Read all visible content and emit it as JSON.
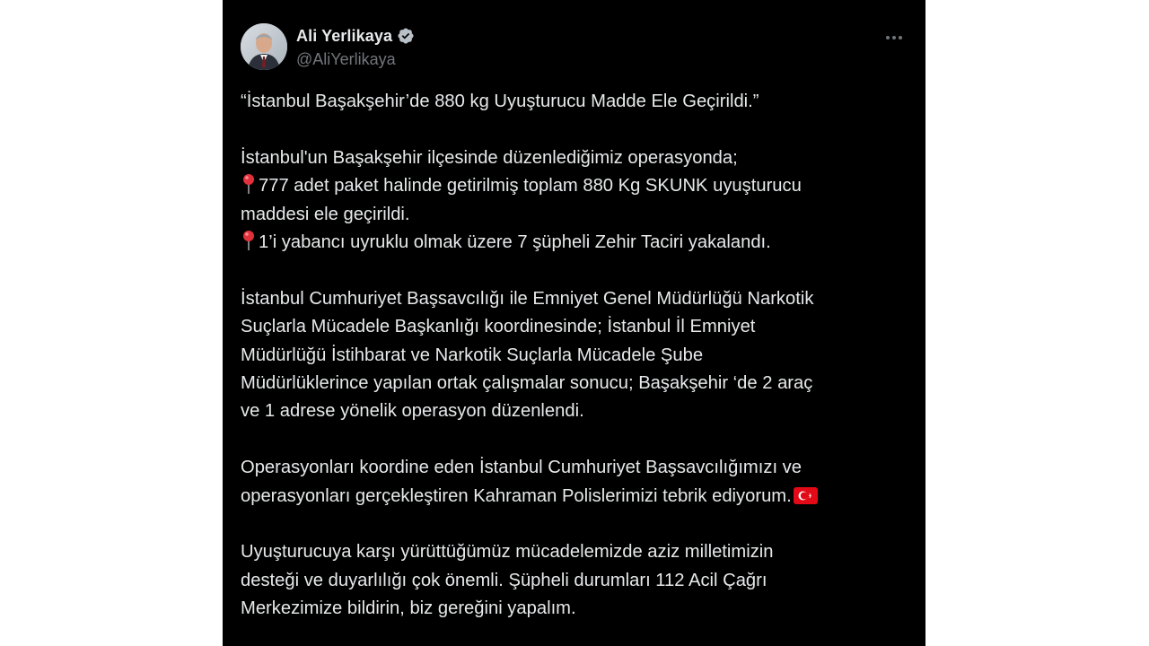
{
  "tweet": {
    "author": {
      "name": "Ali Yerlikaya",
      "handle": "@AliYerlikaya",
      "verified": true,
      "avatar_icon": "profile-photo"
    },
    "more_icon": "more-horizontal-icon",
    "paragraphs": [
      {
        "lines": [
          {
            "text": "“İstanbul Başakşehir’de 880 kg Uyuşturucu Madde Ele Geçirildi.”"
          }
        ]
      },
      {
        "lines": [
          {
            "text": "İstanbul'un Başakşehir ilçesinde düzenlediğimiz operasyonda;"
          },
          {
            "icon": "pin-icon",
            "text": "777 adet paket halinde getirilmiş toplam 880 Kg SKUNK uyuşturucu"
          },
          {
            "text": "maddesi ele geçirildi."
          },
          {
            "icon": "pin-icon",
            "text": "1’i yabancı uyruklu olmak üzere 7 şüpheli Zehir Taciri yakalandı."
          }
        ]
      },
      {
        "lines": [
          {
            "text": "İstanbul Cumhuriyet Başsavcılığı ile Emniyet Genel Müdürlüğü Narkotik"
          },
          {
            "text": "Suçlarla Mücadele Başkanlığı koordinesinde; İstanbul İl Emniyet"
          },
          {
            "text": "Müdürlüğü İstihbarat ve Narkotik Suçlarla Mücadele Şube"
          },
          {
            "text": "Müdürlüklerince yapılan ortak çalışmalar sonucu; Başakşehir ‘de 2 araç"
          },
          {
            "text": "ve 1 adrese yönelik operasyon düzenlendi."
          }
        ]
      },
      {
        "lines": [
          {
            "text": "Operasyonları koordine eden İstanbul Cumhuriyet Başsavcılığımızı ve"
          },
          {
            "text": "operasyonları gerçekleştiren Kahraman Polislerimizi tebrik ediyorum.",
            "trailing_icon": "turkey-flag-icon"
          }
        ]
      },
      {
        "lines": [
          {
            "text": "Uyuşturucuya karşı yürüttüğümüz mücadelemizde aziz milletimizin"
          },
          {
            "text": "desteği ve duyarlılığı çok önemli. Şüpheli durumları 112 Acil Çağrı"
          },
          {
            "text": "Merkezimize bildirin, biz gereğini yapalım."
          }
        ]
      }
    ]
  },
  "colors": {
    "background": "#000000",
    "text": "#e7e9ea",
    "secondary_text": "#71767b",
    "verified_badge": "#b9c0c6",
    "pin": "#e0313b",
    "flag_red": "#e30a17"
  }
}
